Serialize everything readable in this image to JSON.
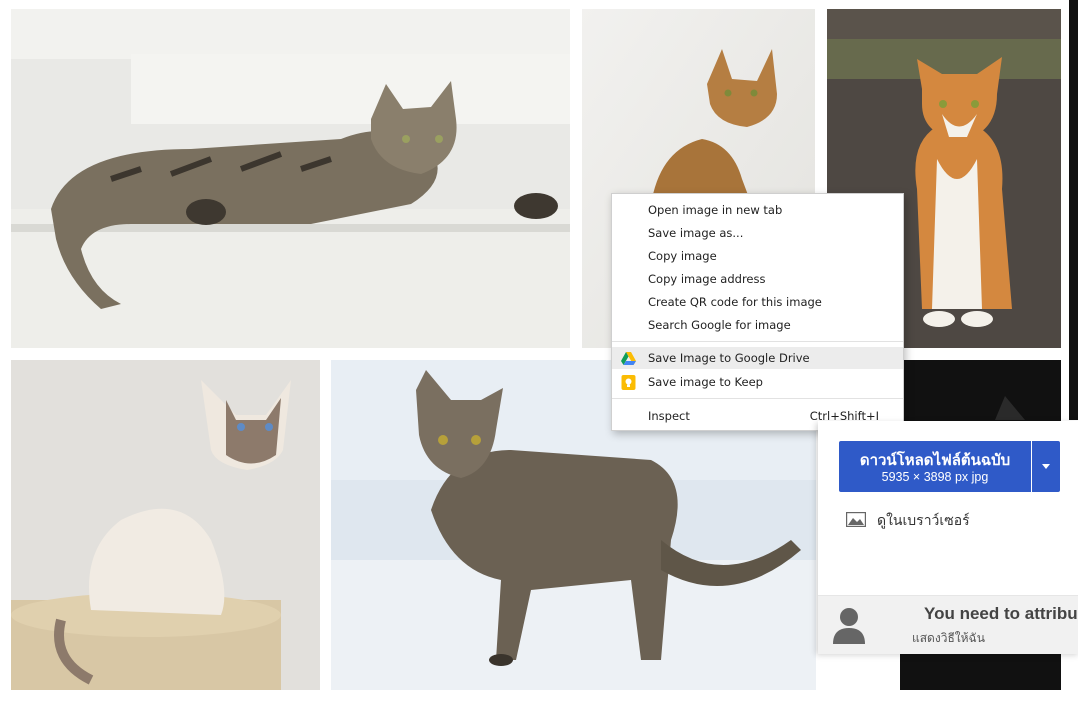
{
  "context_menu": {
    "items": [
      {
        "label": "Open image in new tab"
      },
      {
        "label": "Save image as..."
      },
      {
        "label": "Copy image"
      },
      {
        "label": "Copy image address"
      },
      {
        "label": "Create QR code for this image"
      },
      {
        "label": "Search Google for image"
      },
      {
        "label": "Save Image to Google Drive",
        "icon": "google-drive-icon"
      },
      {
        "label": "Save image to Keep",
        "icon": "google-keep-icon"
      },
      {
        "label": "Inspect",
        "shortcut": "Ctrl+Shift+I"
      }
    ],
    "highlighted": "Save Image to Google Drive"
  },
  "download_panel": {
    "button_label": "ดาวน์โหลดไฟล์ต้นฉบับ",
    "button_sub": "5935 × 3898 px jpg",
    "view_in_browser": "ดูในเบราว์เซอร์",
    "attribution_title": "You need to attribu",
    "attribution_sub": "แสดงวิธีให้ฉัน",
    "accent_color": "#2f5ac8"
  }
}
